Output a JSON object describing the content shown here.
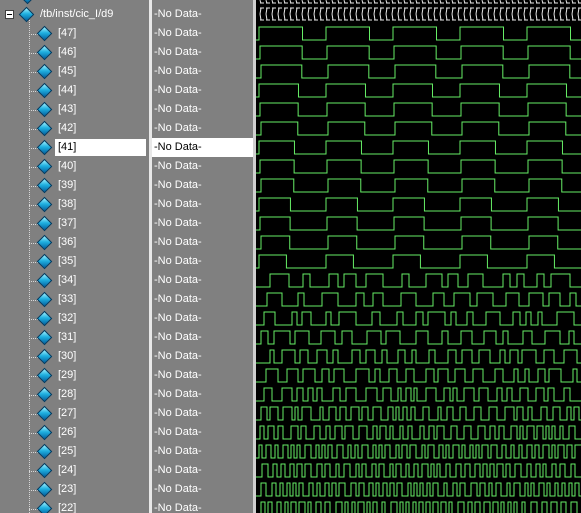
{
  "root_signal": {
    "name": "/tb/inst/cic_I/d9",
    "value": "-No Data-"
  },
  "signals": [
    {
      "name": "[47]",
      "value": "-No Data-"
    },
    {
      "name": "[46]",
      "value": "-No Data-"
    },
    {
      "name": "[45]",
      "value": "-No Data-"
    },
    {
      "name": "[44]",
      "value": "-No Data-"
    },
    {
      "name": "[43]",
      "value": "-No Data-"
    },
    {
      "name": "[42]",
      "value": "-No Data-"
    },
    {
      "name": "[41]",
      "value": "-No Data-",
      "selected": true
    },
    {
      "name": "[40]",
      "value": "-No Data-"
    },
    {
      "name": "[39]",
      "value": "-No Data-"
    },
    {
      "name": "[38]",
      "value": "-No Data-"
    },
    {
      "name": "[37]",
      "value": "-No Data-"
    },
    {
      "name": "[36]",
      "value": "-No Data-"
    },
    {
      "name": "[35]",
      "value": "-No Data-"
    },
    {
      "name": "[34]",
      "value": "-No Data-"
    },
    {
      "name": "[33]",
      "value": "-No Data-"
    },
    {
      "name": "[32]",
      "value": "-No Data-"
    },
    {
      "name": "[31]",
      "value": "-No Data-"
    },
    {
      "name": "[30]",
      "value": "-No Data-"
    },
    {
      "name": "[29]",
      "value": "-No Data-"
    },
    {
      "name": "[28]",
      "value": "-No Data-"
    },
    {
      "name": "[27]",
      "value": "-No Data-"
    },
    {
      "name": "[26]",
      "value": "-No Data-"
    },
    {
      "name": "[25]",
      "value": "-No Data-"
    },
    {
      "name": "[24]",
      "value": "-No Data-"
    },
    {
      "name": "[23]",
      "value": "-No Data-"
    },
    {
      "name": "[22]",
      "value": "-No Data-"
    }
  ],
  "colors": {
    "wave": "#66ee66",
    "bus": "#e8e8e8",
    "wave_bg": "#000000",
    "panel_bg": "#808080"
  }
}
